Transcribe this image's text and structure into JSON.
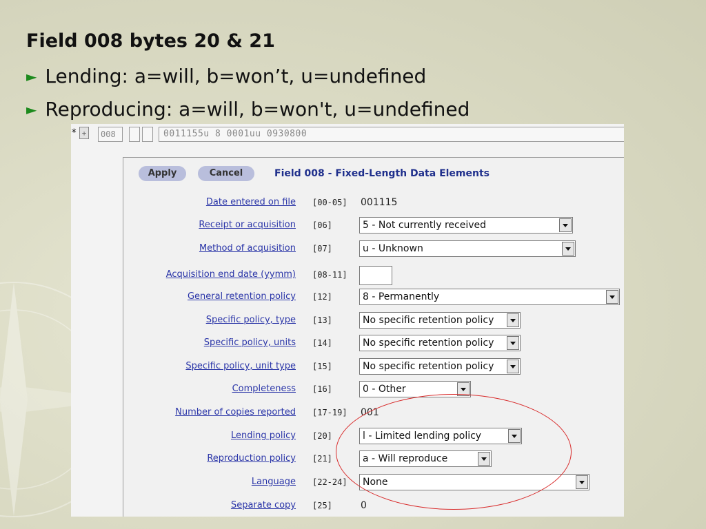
{
  "slide": {
    "title": "Field 008 bytes 20 & 21",
    "bullets": [
      "Lending: a=will, b=won’t, u=undefined",
      "Reproducing: a=will, b=won't, u=undefined"
    ],
    "bullet_marker": "►"
  },
  "tag_row": {
    "marker": "*",
    "add_label": "+",
    "tag": "008",
    "value": "0011155u   8   0001uu   0930800"
  },
  "editor": {
    "apply_label": "Apply",
    "cancel_label": "Cancel",
    "title": "Field 008 - Fixed-Length Data Elements",
    "rows": [
      {
        "label": "Date entered on file",
        "pos": "[00-05]",
        "value": "001115"
      },
      {
        "label": "Receipt or acquisition",
        "pos": "[06]",
        "value": "5 - Not currently received"
      },
      {
        "label": "Method of acquisition",
        "pos": "[07]",
        "value": "u - Unknown"
      },
      {
        "label": "Acquisition end date (yymm)",
        "pos": "[08-11]",
        "value": ""
      },
      {
        "label": "General retention policy",
        "pos": "[12]",
        "value": "8 - Permanently"
      },
      {
        "label": "Specific policy, type",
        "pos": "[13]",
        "value": "No specific retention policy"
      },
      {
        "label": "Specific policy, units",
        "pos": "[14]",
        "value": "No specific retention policy"
      },
      {
        "label": "Specific policy, unit type",
        "pos": "[15]",
        "value": "No specific retention policy"
      },
      {
        "label": "Completeness",
        "pos": "[16]",
        "value": "0 - Other"
      },
      {
        "label": "Number of copies reported",
        "pos": "[17-19]",
        "value": "001"
      },
      {
        "label": "Lending policy",
        "pos": "[20]",
        "value": "l - Limited lending policy"
      },
      {
        "label": "Reproduction policy",
        "pos": "[21]",
        "value": "a - Will reproduce"
      },
      {
        "label": "Language",
        "pos": "[22-24]",
        "value": "None"
      },
      {
        "label": "Separate copy",
        "pos": "[25]",
        "value": "0"
      }
    ]
  },
  "colors": {
    "label_link": "#2a35a8",
    "title_blue": "#1f2f8c",
    "button_pill": "#b9bedc",
    "annotation_red": "#d82a2a",
    "bullet_green": "#1d8a1d"
  }
}
